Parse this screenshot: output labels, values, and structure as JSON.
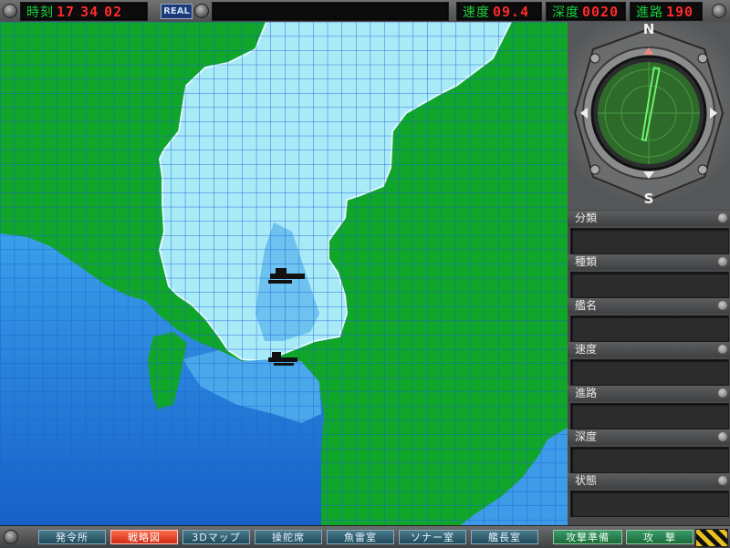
{
  "topbar": {
    "clock": {
      "label": "時刻",
      "hh": "17",
      "mm": "34",
      "ss": "02"
    },
    "real_button": "REAL",
    "speed": {
      "label": "速度",
      "value": "09.4"
    },
    "depth": {
      "label": "深度",
      "value": "0020"
    },
    "course": {
      "label": "進路",
      "value": "190"
    }
  },
  "compass": {
    "north": "N",
    "south": "S",
    "heading_deg": 190
  },
  "info_panel": [
    {
      "key": "classification",
      "label": "分類"
    },
    {
      "key": "type",
      "label": "種類"
    },
    {
      "key": "ship_name",
      "label": "艦名"
    },
    {
      "key": "speed",
      "label": "速度"
    },
    {
      "key": "course",
      "label": "進路"
    },
    {
      "key": "depth",
      "label": "深度"
    },
    {
      "key": "status",
      "label": "状態"
    }
  ],
  "bottom_nav": [
    {
      "label": "発令所",
      "active": false
    },
    {
      "label": "戦略図",
      "active": true
    },
    {
      "label": "3Dマップ",
      "active": false
    },
    {
      "label": "操舵席",
      "active": false
    },
    {
      "label": "魚雷室",
      "active": false
    },
    {
      "label": "ソナー室",
      "active": false
    },
    {
      "label": "艦長室",
      "active": false
    }
  ],
  "actions": {
    "prepare": "攻撃準備",
    "attack": "攻　撃"
  },
  "colors": {
    "land": "#10a62a",
    "shallow": "#a8eaf6",
    "deep": "#1e7fd8",
    "grid": "#1c5fd8",
    "lcd_red": "#ff2a2a",
    "lcd_green": "#19d23a"
  }
}
